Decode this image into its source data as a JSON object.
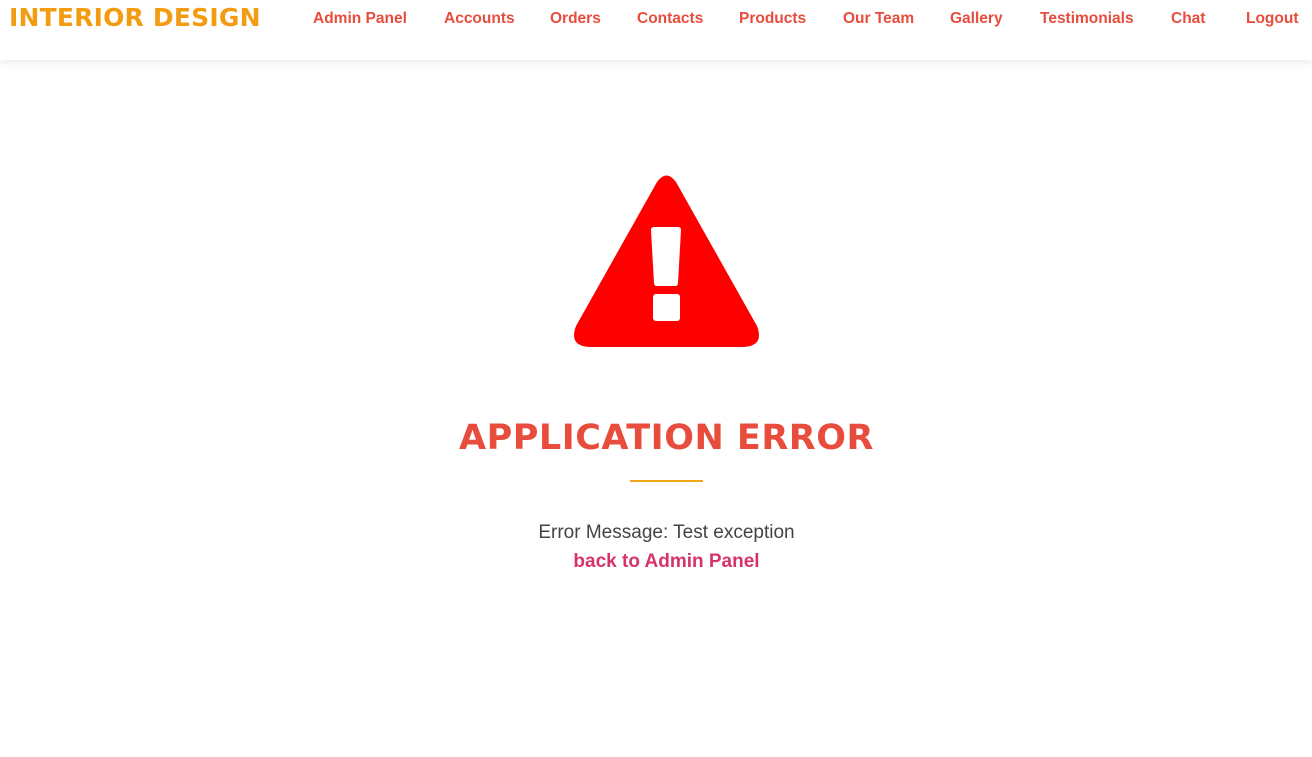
{
  "header": {
    "brand": "INTERIOR DESIGN",
    "nav": [
      {
        "label": "Admin Panel"
      },
      {
        "label": "Accounts"
      },
      {
        "label": "Orders"
      },
      {
        "label": "Contacts"
      },
      {
        "label": "Products"
      },
      {
        "label": "Our Team"
      },
      {
        "label": "Gallery"
      },
      {
        "label": "Testimonials"
      },
      {
        "label": "Chat"
      },
      {
        "label": "Logout"
      }
    ]
  },
  "main": {
    "icon": "warning-triangle-icon",
    "title": "APPLICATION ERROR",
    "message": "Error Message: Test exception",
    "back_link": "back to Admin Panel"
  },
  "colors": {
    "brand": "#f39c12",
    "nav": "#e74c3c",
    "title": "#e74c3c",
    "icon": "#ff0000",
    "divider": "#f0a81a",
    "link": "#d6336c",
    "message": "#444444"
  }
}
